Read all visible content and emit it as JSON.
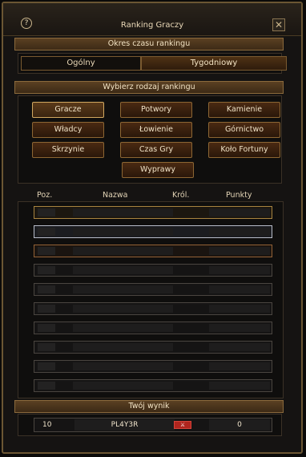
{
  "window": {
    "title": "Ranking Graczy",
    "help_label": "?",
    "close_label": "✕"
  },
  "period": {
    "header": "Okres czasu rankingu",
    "tabs": [
      {
        "label": "Ogólny",
        "active": true
      },
      {
        "label": "Tygodniowy",
        "active": false
      }
    ]
  },
  "type": {
    "header": "Wybierz rodzaj rankingu",
    "buttons": [
      {
        "label": "Gracze",
        "selected": true
      },
      {
        "label": "Potwory",
        "selected": false
      },
      {
        "label": "Kamienie",
        "selected": false
      },
      {
        "label": "Władcy",
        "selected": false
      },
      {
        "label": "Łowienie",
        "selected": false
      },
      {
        "label": "Górnictwo",
        "selected": false
      },
      {
        "label": "Skrzynie",
        "selected": false
      },
      {
        "label": "Czas Gry",
        "selected": false
      },
      {
        "label": "Koło Fortuny",
        "selected": false
      },
      {
        "label": "Wyprawy",
        "selected": false
      }
    ]
  },
  "table": {
    "columns": [
      "Poz.",
      "Nazwa",
      "Król.",
      "Punkty"
    ],
    "row_count": 10
  },
  "your_score": {
    "header": "Twój wynik",
    "position": "10",
    "name": "PL4Y3R",
    "kingdom_flag": "⚔",
    "points": "0"
  },
  "colors": {
    "gold": "#a88440",
    "silver": "#b8bcc8",
    "bronze": "#946236",
    "kingdom_red": "#b0251e"
  }
}
